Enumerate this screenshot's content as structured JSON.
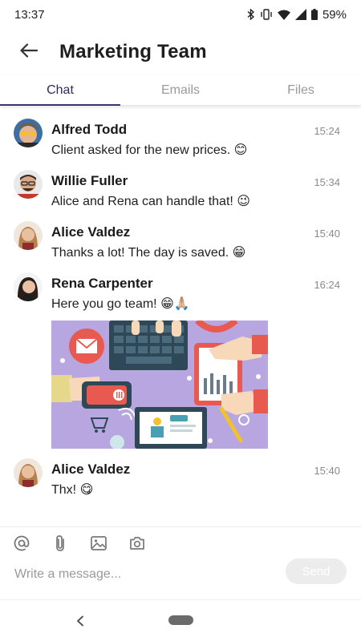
{
  "status_bar": {
    "time": "13:37",
    "battery": "59%",
    "icons": [
      "bluetooth-icon",
      "vibrate-icon",
      "wifi-icon",
      "signal-icon",
      "battery-icon"
    ]
  },
  "header": {
    "back_icon": "arrow-left-icon",
    "title": "Marketing Team"
  },
  "tabs": [
    {
      "label": "Chat",
      "active": true
    },
    {
      "label": "Emails",
      "active": false
    },
    {
      "label": "Files",
      "active": false
    }
  ],
  "messages": [
    {
      "sender": "Alfred Todd",
      "time": "15:24",
      "text": "Client asked for the new prices.",
      "emoji": "😊"
    },
    {
      "sender": "Willie Fuller",
      "time": "15:34",
      "text": "Alice and Rena can handle that!",
      "emoji": "😉"
    },
    {
      "sender": "Alice Valdez",
      "time": "15:40",
      "text": "Thanks a lot! The day is saved.",
      "emoji": "😁"
    },
    {
      "sender": "Rena Carpenter",
      "time": "16:24",
      "text": "Here you go team!",
      "emoji": "😁🙏🏼"
    },
    {
      "sender": "Alice Valdez",
      "time": "15:40",
      "text": "Thx!",
      "emoji": "😋"
    }
  ],
  "composer": {
    "icons": [
      "at-icon",
      "attachment-icon",
      "image-icon",
      "camera-icon"
    ],
    "placeholder": "Write a message...",
    "send_label": "Send"
  },
  "nav_bar": {
    "icons": [
      "nav-back-icon",
      "nav-home-pill"
    ]
  },
  "colors": {
    "accent": "#3a3470",
    "tab_inactive": "#9a9a9a",
    "send_disabled": "#ececec"
  }
}
